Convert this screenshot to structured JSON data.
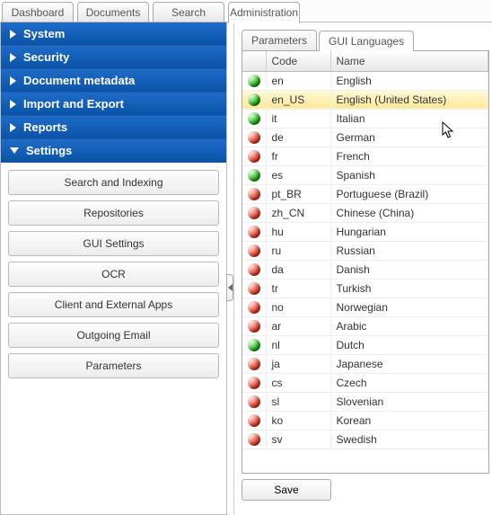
{
  "main_tabs": [
    {
      "label": "Dashboard",
      "active": false
    },
    {
      "label": "Documents",
      "active": false
    },
    {
      "label": "Search",
      "active": false
    },
    {
      "label": "Administration",
      "active": true
    }
  ],
  "sidebar": {
    "items": [
      {
        "label": "System",
        "expanded": false
      },
      {
        "label": "Security",
        "expanded": false
      },
      {
        "label": "Document metadata",
        "expanded": false
      },
      {
        "label": "Import and Export",
        "expanded": false
      },
      {
        "label": "Reports",
        "expanded": false
      },
      {
        "label": "Settings",
        "expanded": true
      }
    ],
    "settings_children": [
      "Search and Indexing",
      "Repositories",
      "GUI Settings",
      "OCR",
      "Client and External Apps",
      "Outgoing Email",
      "Parameters"
    ]
  },
  "sub_tabs": [
    {
      "label": "Parameters",
      "active": false
    },
    {
      "label": "GUI Languages",
      "active": true
    }
  ],
  "table": {
    "headers": {
      "status": "",
      "code": "Code",
      "name": "Name"
    },
    "rows": [
      {
        "status": "green",
        "code": "en",
        "name": "English",
        "selected": false
      },
      {
        "status": "green",
        "code": "en_US",
        "name": "English (United States)",
        "selected": true
      },
      {
        "status": "green",
        "code": "it",
        "name": "Italian",
        "selected": false
      },
      {
        "status": "red",
        "code": "de",
        "name": "German",
        "selected": false
      },
      {
        "status": "red",
        "code": "fr",
        "name": "French",
        "selected": false
      },
      {
        "status": "green",
        "code": "es",
        "name": "Spanish",
        "selected": false
      },
      {
        "status": "red",
        "code": "pt_BR",
        "name": "Portuguese (Brazil)",
        "selected": false
      },
      {
        "status": "red",
        "code": "zh_CN",
        "name": "Chinese (China)",
        "selected": false
      },
      {
        "status": "red",
        "code": "hu",
        "name": "Hungarian",
        "selected": false
      },
      {
        "status": "red",
        "code": "ru",
        "name": "Russian",
        "selected": false
      },
      {
        "status": "red",
        "code": "da",
        "name": "Danish",
        "selected": false
      },
      {
        "status": "red",
        "code": "tr",
        "name": "Turkish",
        "selected": false
      },
      {
        "status": "red",
        "code": "no",
        "name": "Norwegian",
        "selected": false
      },
      {
        "status": "red",
        "code": "ar",
        "name": "Arabic",
        "selected": false
      },
      {
        "status": "green",
        "code": "nl",
        "name": "Dutch",
        "selected": false
      },
      {
        "status": "red",
        "code": "ja",
        "name": "Japanese",
        "selected": false
      },
      {
        "status": "red",
        "code": "cs",
        "name": "Czech",
        "selected": false
      },
      {
        "status": "red",
        "code": "sl",
        "name": "Slovenian",
        "selected": false
      },
      {
        "status": "red",
        "code": "ko",
        "name": "Korean",
        "selected": false
      },
      {
        "status": "red",
        "code": "sv",
        "name": "Swedish",
        "selected": false
      }
    ]
  },
  "buttons": {
    "save": "Save"
  }
}
